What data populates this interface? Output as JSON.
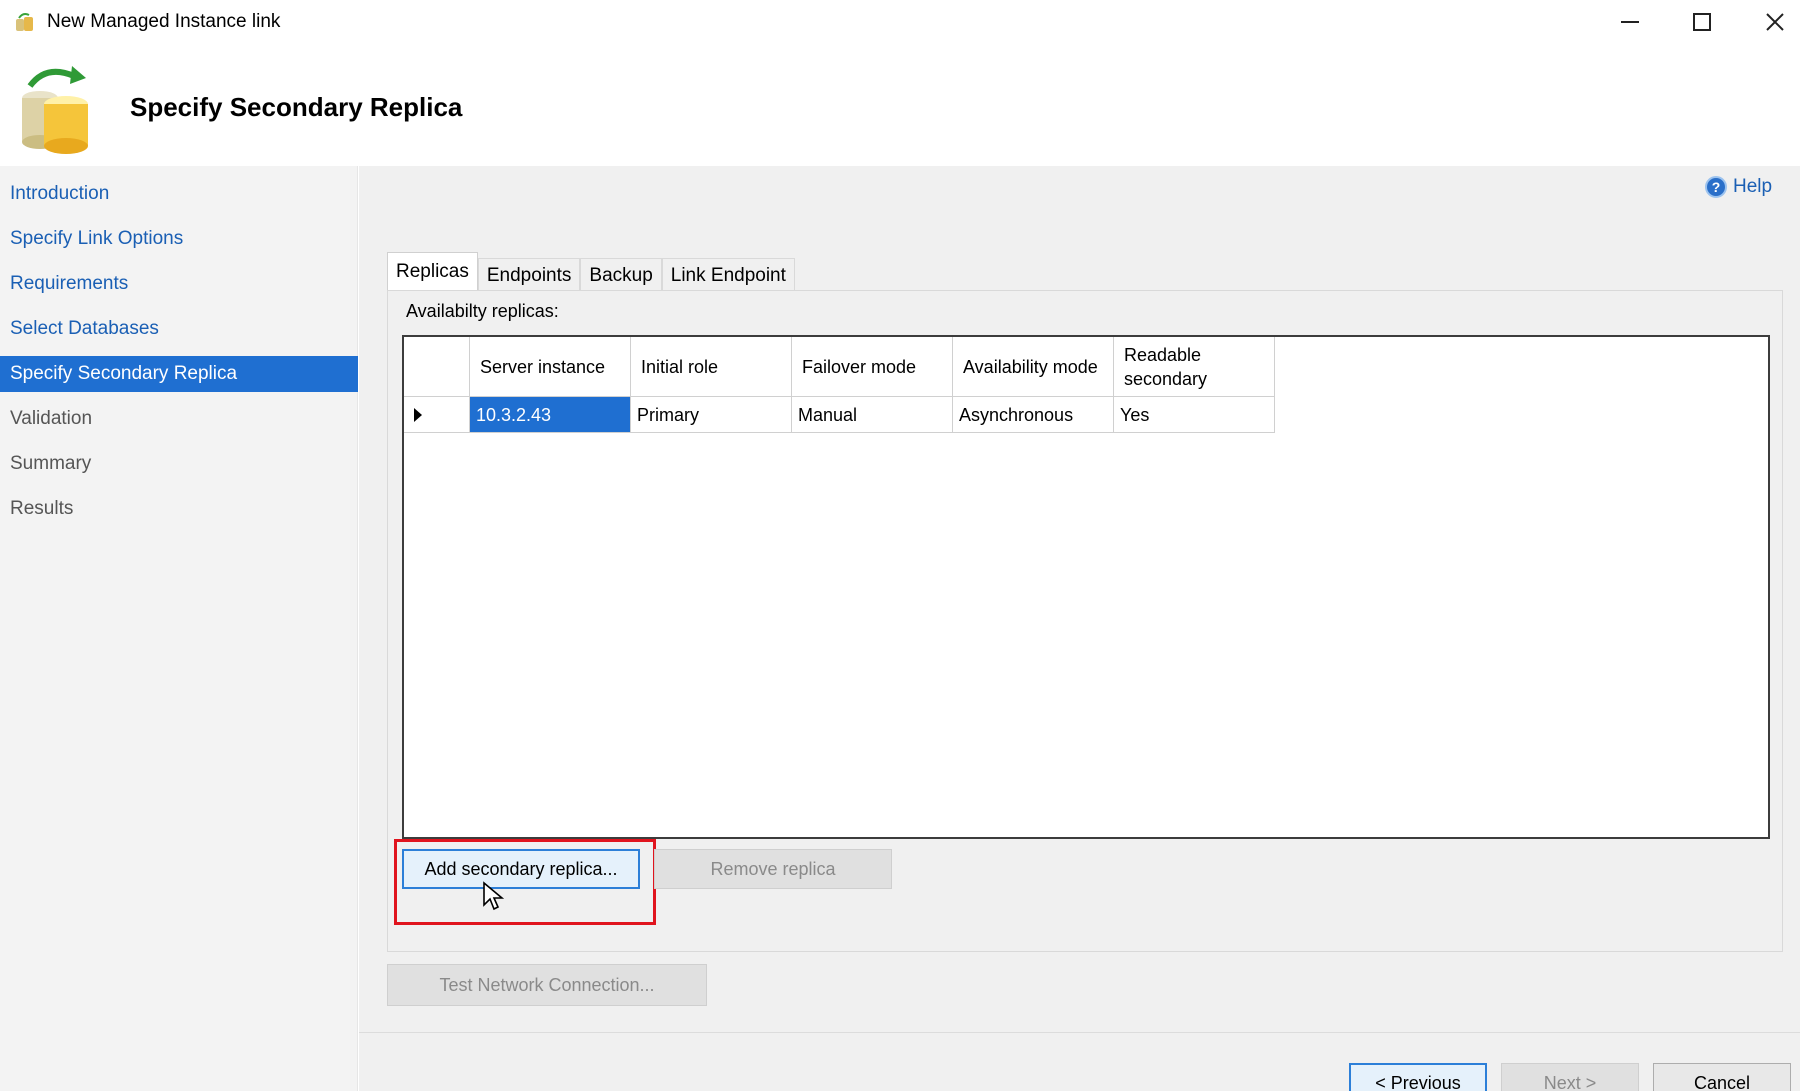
{
  "window": {
    "title": "New Managed Instance link",
    "controls": {
      "minimize": "minimize-icon",
      "maximize": "maximize-icon",
      "close": "close-icon"
    }
  },
  "header": {
    "title": "Specify Secondary Replica",
    "icon": "database-sync-icon"
  },
  "sidebar": {
    "items": [
      {
        "label": "Introduction",
        "state": "link"
      },
      {
        "label": "Specify Link Options",
        "state": "link"
      },
      {
        "label": "Requirements",
        "state": "link"
      },
      {
        "label": "Select Databases",
        "state": "link"
      },
      {
        "label": "Specify Secondary Replica",
        "state": "active"
      },
      {
        "label": "Validation",
        "state": "disabled"
      },
      {
        "label": "Summary",
        "state": "disabled"
      },
      {
        "label": "Results",
        "state": "disabled"
      }
    ]
  },
  "help": {
    "label": "Help"
  },
  "tabs": [
    {
      "label": "Replicas",
      "active": true
    },
    {
      "label": "Endpoints",
      "active": false
    },
    {
      "label": "Backup",
      "active": false
    },
    {
      "label": "Link Endpoint",
      "active": false
    }
  ],
  "replicas": {
    "section_label": "Availabilty replicas:",
    "columns": [
      "Server instance",
      "Initial role",
      "Failover mode",
      "Availability mode",
      "Readable secondary"
    ],
    "rows": [
      [
        "10.3.2.43",
        "Primary",
        "Manual",
        "Asynchronous",
        "Yes"
      ]
    ],
    "add_button": "Add secondary replica...",
    "remove_button": "Remove replica"
  },
  "test_button": "Test Network Connection...",
  "footer": {
    "previous": "< Previous",
    "next": "Next >",
    "cancel": "Cancel"
  },
  "colors": {
    "accent": "#1f6fd1",
    "link": "#1a5fb4",
    "highlight": "#e0141e"
  }
}
